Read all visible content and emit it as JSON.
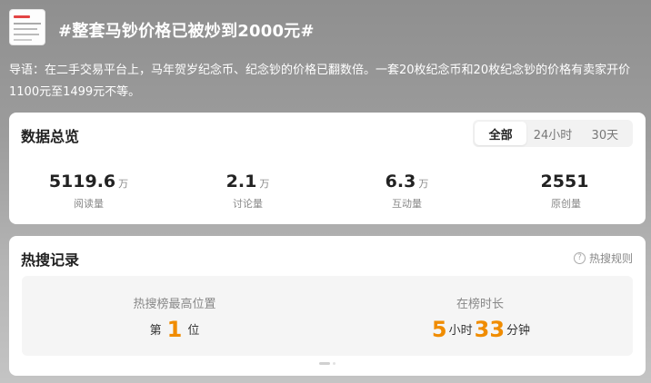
{
  "header": {
    "title": "#整套马钞价格已被炒到2000元#"
  },
  "lead": "导语：在二手交易平台上，马年贺岁纪念币、纪念钞的价格已翻数倍。一套20枚纪念币和20枚纪念钞的价格有卖家开价1100元至1499元不等。",
  "overview": {
    "title": "数据总览",
    "tabs": [
      {
        "label": "全部",
        "active": true
      },
      {
        "label": "24小时",
        "active": false
      },
      {
        "label": "30天",
        "active": false
      }
    ],
    "stats": [
      {
        "value": "5119.6",
        "unit": "万",
        "label": "阅读量"
      },
      {
        "value": "2.1",
        "unit": "万",
        "label": "讨论量"
      },
      {
        "value": "6.3",
        "unit": "万",
        "label": "互动量"
      },
      {
        "value": "2551",
        "unit": "",
        "label": "原创量"
      }
    ]
  },
  "hot": {
    "title": "热搜记录",
    "rule_label": "热搜规则",
    "rule_icon": "question-circle-icon",
    "peak": {
      "caption": "热搜榜最高位置",
      "prefix": "第",
      "value": "1",
      "suffix": "位"
    },
    "duration": {
      "caption": "在榜时长",
      "hours": "5",
      "hours_unit": "小时",
      "minutes": "33",
      "minutes_unit": "分钟"
    }
  },
  "colors": {
    "accent": "#f08c00",
    "background": "#9c9c9c",
    "card": "#ffffff"
  }
}
